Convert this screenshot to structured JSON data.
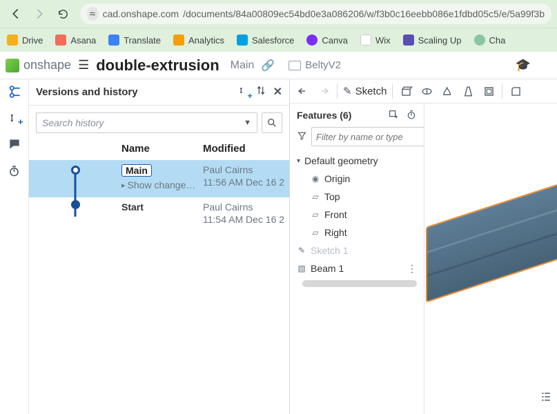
{
  "browser": {
    "url_host": "cad.onshape.com",
    "url_path": "/documents/84a00809ec54bd0e3a086206/w/f3b0c16eebb086e1fdbd05c5/e/5a99f3b"
  },
  "bookmarks": [
    {
      "label": "Drive",
      "color": "#f2b01e"
    },
    {
      "label": "Asana",
      "color": "#f26d5b"
    },
    {
      "label": "Translate",
      "color": "#3b82f6"
    },
    {
      "label": "Analytics",
      "color": "#f59e0b"
    },
    {
      "label": "Salesforce",
      "color": "#00a1e0"
    },
    {
      "label": "Canva",
      "color": "#7b2ff2"
    },
    {
      "label": "Wix",
      "color": "#f5c518"
    },
    {
      "label": "Scaling Up",
      "color": "#5b4db1"
    },
    {
      "label": "Cha",
      "color": "#8ac6a1"
    }
  ],
  "app": {
    "brand": "onshape",
    "doc_name": "double-extrusion",
    "tab": "Main",
    "crumb": "BeltyV2"
  },
  "versions_panel": {
    "title": "Versions and history",
    "search_placeholder": "Search history",
    "columns": {
      "name": "Name",
      "modified": "Modified"
    },
    "rows": [
      {
        "name": "Main",
        "is_main": true,
        "show_changes": "Show change…",
        "author": "Paul Cairns",
        "time": "11:56 AM Dec 16 2",
        "selected": true
      },
      {
        "name": "Start",
        "is_main": false,
        "author": "Paul Cairns",
        "time": "11:54 AM Dec 16 2",
        "selected": false
      }
    ]
  },
  "toolbar": {
    "sketch_label": "Sketch"
  },
  "features": {
    "header": "Features (6)",
    "filter_placeholder": "Filter by name or type",
    "default_geometry_label": "Default geometry",
    "origin": "Origin",
    "planes": [
      "Top",
      "Front",
      "Right"
    ],
    "sketch": "Sketch 1",
    "beam": "Beam 1"
  }
}
